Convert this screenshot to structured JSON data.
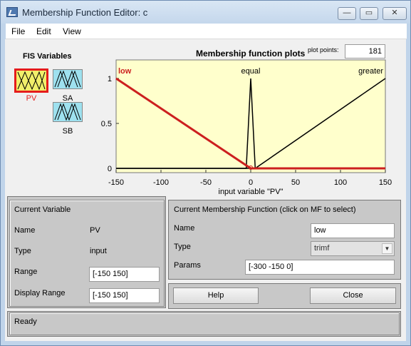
{
  "window": {
    "title": "Membership Function Editor: c",
    "controls": {
      "minimize": "—",
      "maximize": "▭",
      "close": "✕"
    }
  },
  "menu": {
    "items": [
      "File",
      "Edit",
      "View"
    ]
  },
  "fis_variables": {
    "title": "FIS Variables",
    "inputs": [
      {
        "name": "PV",
        "selected": true
      }
    ],
    "outputs": [
      {
        "name": "SA"
      },
      {
        "name": "SB"
      }
    ],
    "icon_colors": {
      "input": "#f1ef6a",
      "output": "#9ee1ef",
      "selected_border": "#e51c1c"
    }
  },
  "plot": {
    "title": "Membership function plots",
    "plot_points_label": "plot points:",
    "plot_points": "181",
    "xlabel": "input variable \"PV\"",
    "x_ticks": [
      "-150",
      "-100",
      "-50",
      "0",
      "50",
      "100",
      "150"
    ],
    "y_ticks": [
      "0",
      "0.5",
      "1"
    ],
    "bg_color": "#ffffcc",
    "selected_color": "#cc1f1f",
    "mf_labels": [
      {
        "text": "low",
        "selected": true
      },
      {
        "text": "equal"
      },
      {
        "text": "greater"
      }
    ]
  },
  "chart_data": {
    "type": "line",
    "xlim": [
      -150,
      150
    ],
    "ylim": [
      0,
      1
    ],
    "series": [
      {
        "name": "low",
        "x": [
          -150,
          0,
          150
        ],
        "y": [
          1,
          0,
          0
        ],
        "selected": true
      },
      {
        "name": "equal",
        "x": [
          -150,
          -5,
          0,
          5,
          150
        ],
        "y": [
          0,
          0,
          1,
          0,
          0
        ]
      },
      {
        "name": "greater",
        "x": [
          -150,
          5,
          150
        ],
        "y": [
          0,
          0,
          1
        ]
      }
    ]
  },
  "current_variable": {
    "header": "Current Variable",
    "name_label": "Name",
    "name_value": "PV",
    "type_label": "Type",
    "type_value": "input",
    "range_label": "Range",
    "range_value": "[-150 150]",
    "display_range_label": "Display Range",
    "display_range_value": "[-150 150]"
  },
  "current_mf": {
    "header": "Current Membership Function (click on MF to select)",
    "name_label": "Name",
    "name_value": "low",
    "type_label": "Type",
    "type_value": "trimf",
    "params_label": "Params",
    "params_value": "[-300 -150 0]"
  },
  "buttons": {
    "help": "Help",
    "close": "Close"
  },
  "status": {
    "text": "Ready"
  }
}
